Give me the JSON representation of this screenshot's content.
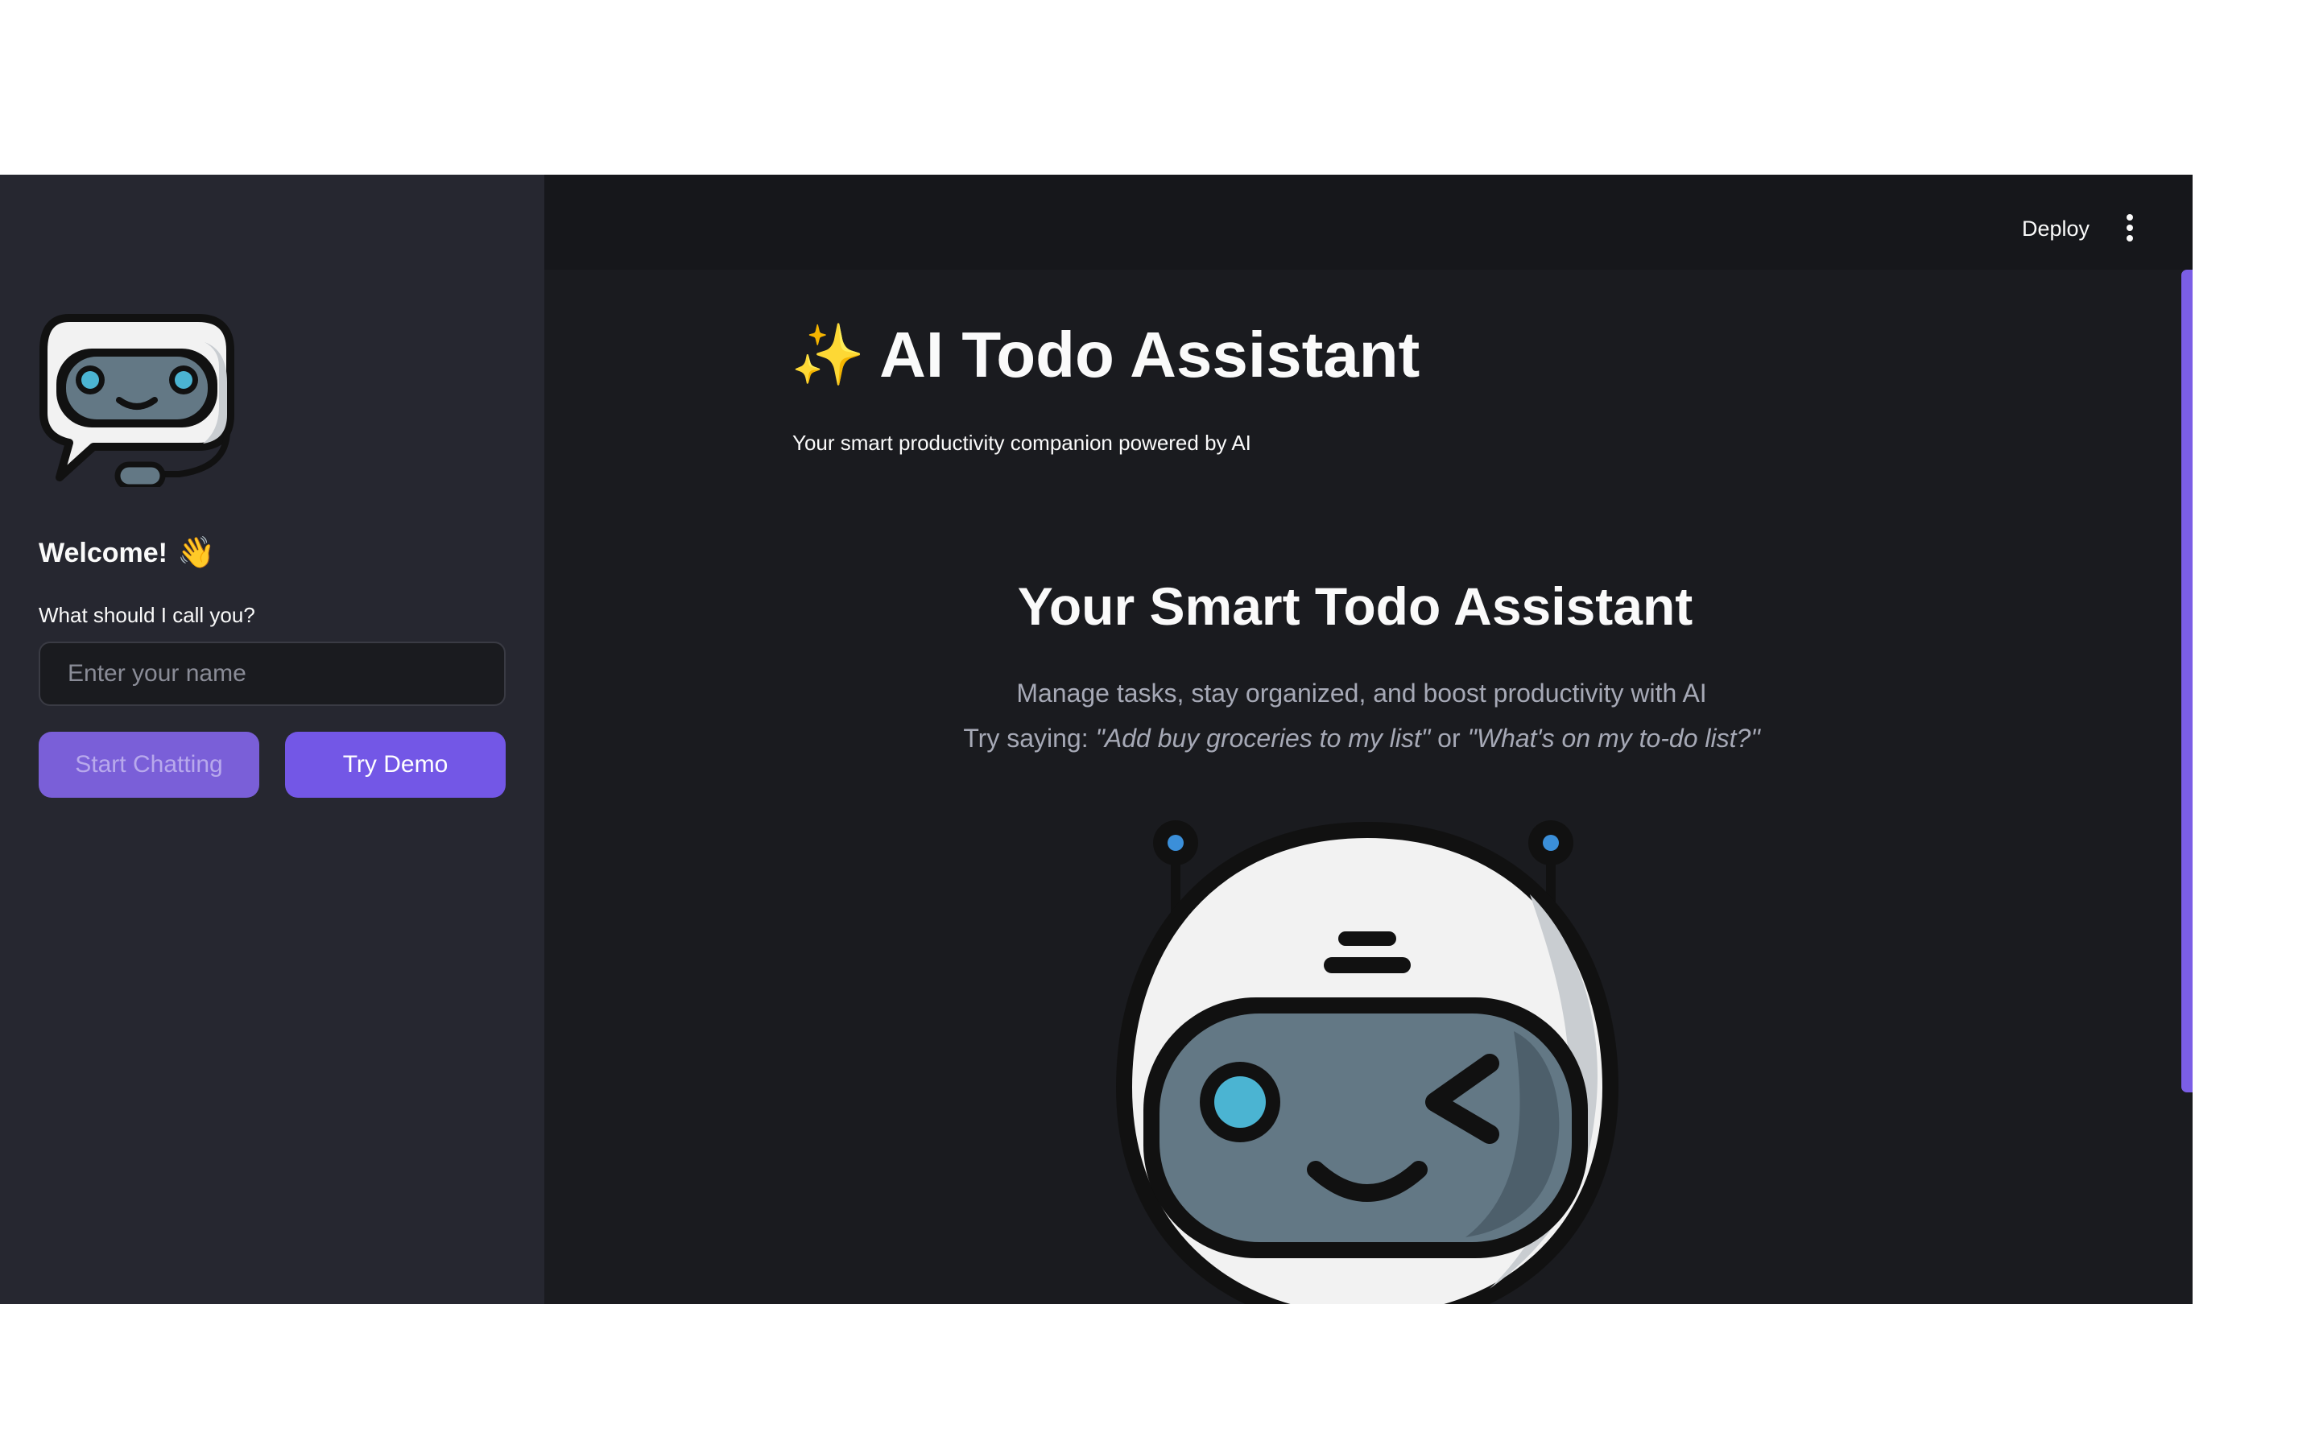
{
  "header": {
    "deploy_label": "Deploy",
    "menu_icon": "more-vertical-icon"
  },
  "sidebar": {
    "logo_icon": "robot-chat-icon",
    "welcome_title": "Welcome!",
    "welcome_emoji": "👋",
    "name_label": "What should I call you?",
    "name_placeholder": "Enter your name",
    "name_value": "",
    "start_button": "Start Chatting",
    "demo_button": "Try Demo"
  },
  "main": {
    "title_emoji": "✨",
    "title": "AI Todo Assistant",
    "subtitle": "Your smart productivity companion powered by AI",
    "hero_title": "Your Smart Todo Assistant",
    "hero_description": "Manage tasks, stay organized, and boost productivity with AI",
    "try_prefix": "Try saying: ",
    "try_example_1": "\"Add buy groceries to my list\"",
    "try_connector": " or ",
    "try_example_2": "\"What's on my to-do list?\"",
    "hero_icon": "robot-wink-icon"
  },
  "colors": {
    "background": "#1a1b1f",
    "sidebar": "#262730",
    "accent": "#7357e6",
    "text": "#fafafa",
    "muted_text": "#a6a9b6"
  }
}
